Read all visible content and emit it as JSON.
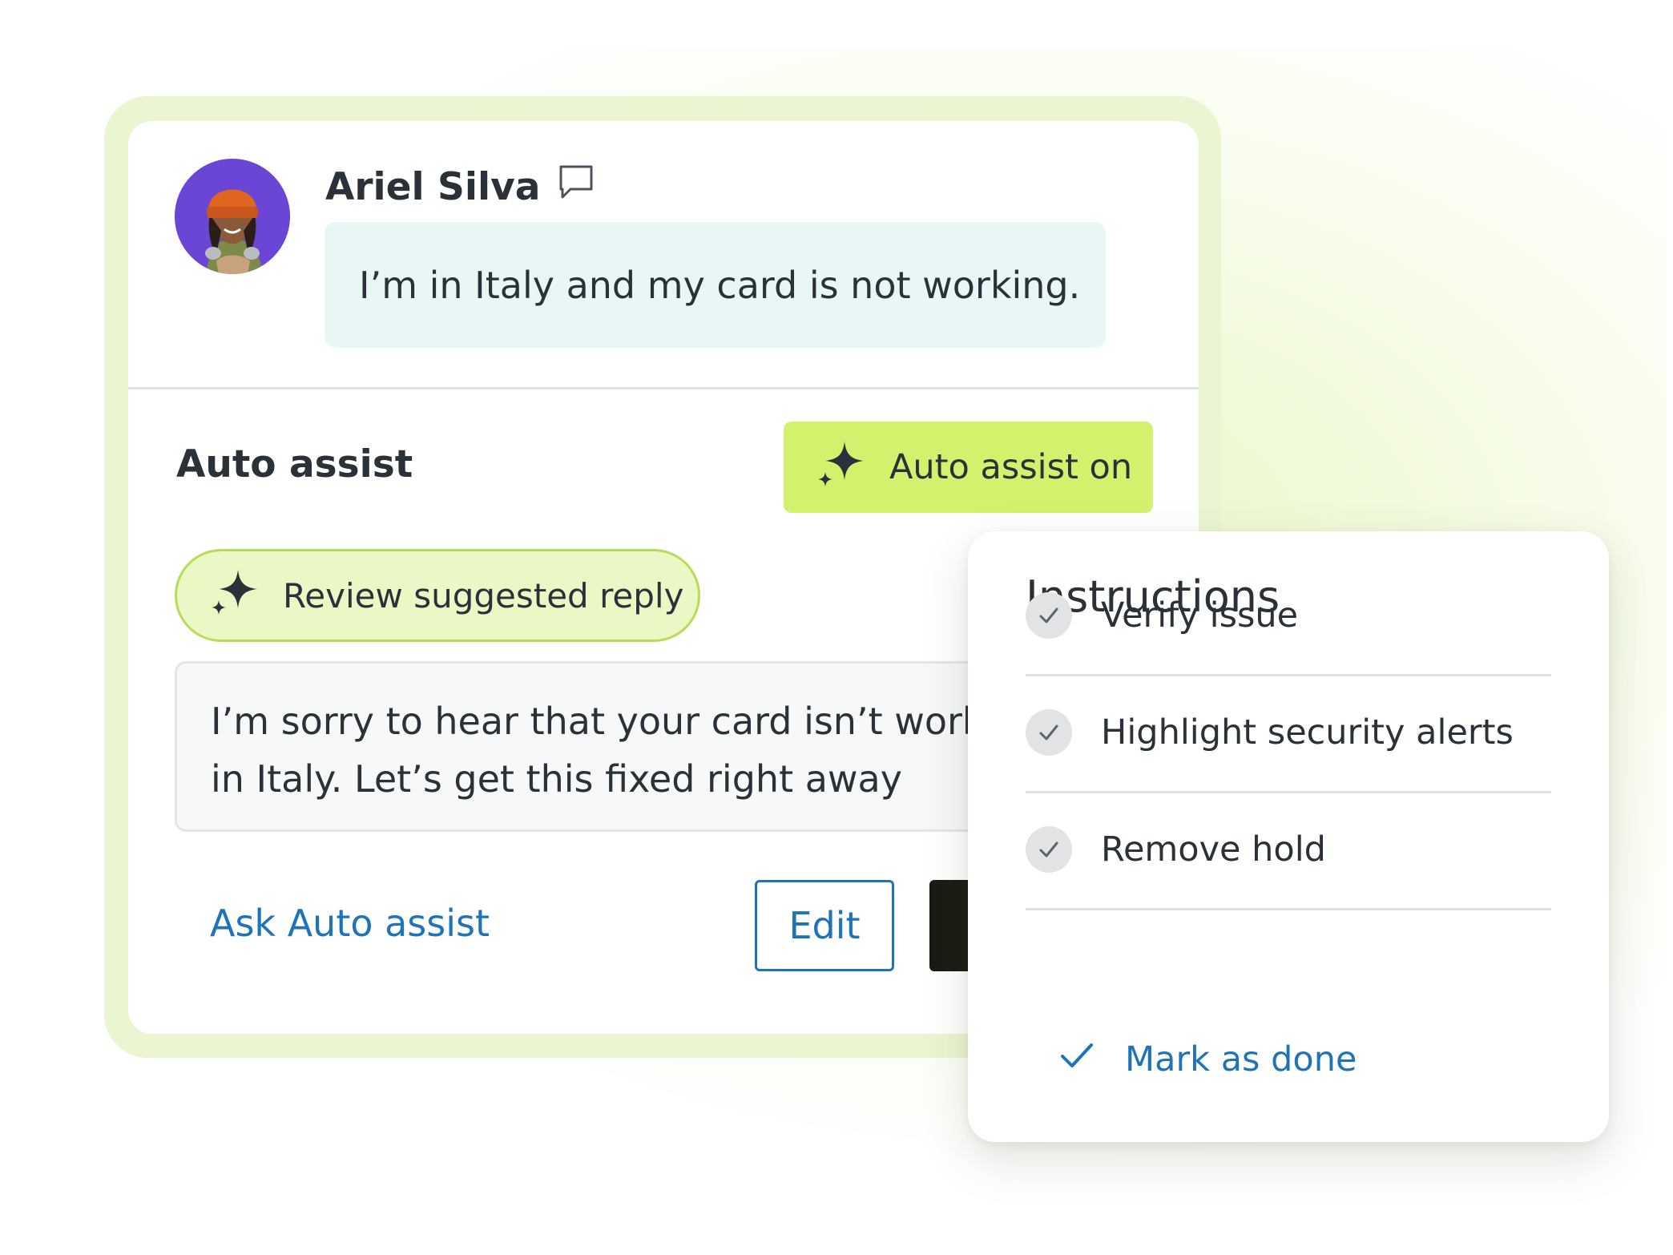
{
  "conversation": {
    "sender_name": "Ariel Silva",
    "message": "I’m in Italy and my card is not working.",
    "channel_icon": "chat-bubble-icon"
  },
  "auto_assist": {
    "title": "Auto assist",
    "toggle_label": "Auto assist on",
    "toggle_color": "#d2f26e",
    "review_label": "Review suggested reply",
    "reply_lines": [
      "I’m sorry to hear that your card isn’t work",
      "in Italy. Let’s get this fixed right away"
    ],
    "ask_link": "Ask Auto assist",
    "edit_label": "Edit"
  },
  "instructions": {
    "title": "Instructions",
    "items": [
      {
        "label": "Verify issue",
        "done": true
      },
      {
        "label": "Highlight security alerts",
        "done": true
      },
      {
        "label": "Remove hold",
        "done": true
      }
    ],
    "mark_done_label": "Mark as done"
  },
  "colors": {
    "accent_blue": "#1f73b7",
    "assist_green": "#d2f26e",
    "bubble_bg": "#e8f7f6",
    "avatar_bg": "#6a45d6"
  }
}
